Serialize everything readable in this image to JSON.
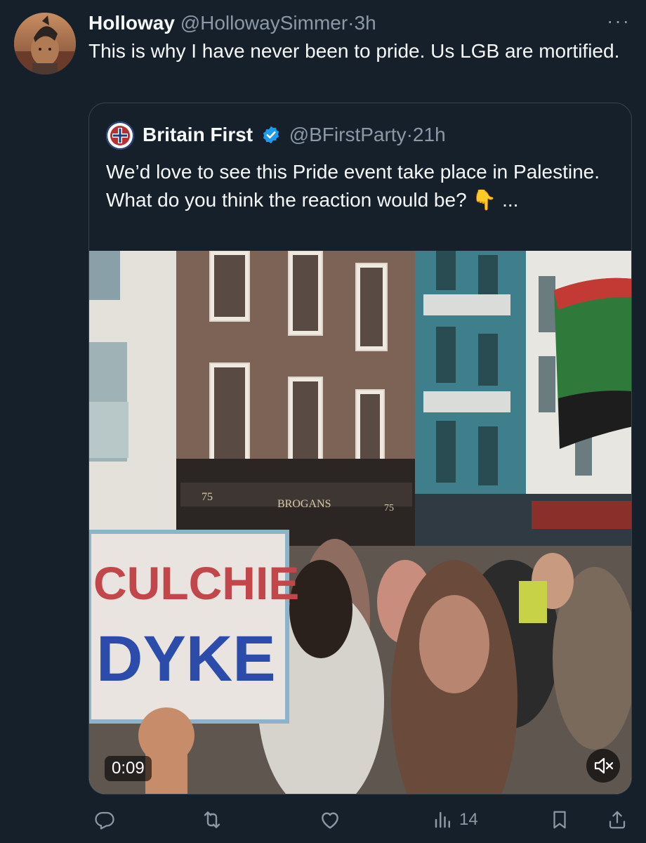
{
  "tweet": {
    "display_name": "Holloway",
    "handle": "@HollowaySimmer",
    "separator": "·",
    "time": "3h",
    "more_label": "···",
    "text": "This is why I have never been to pride. Us LGB are mortified.",
    "avatar_icon": "user-avatar"
  },
  "quote": {
    "display_name": "Britain First",
    "verified_icon": "verified-badge-icon",
    "handle": "@BFirstParty",
    "separator": "·",
    "time": "21h",
    "text": "We’d love to see this Pride event take place in Palestine.\nWhat do you think the reaction would be? 👇 ...",
    "avatar_icon": "britain-first-logo"
  },
  "media": {
    "type": "video",
    "duration": "0:09",
    "mute_icon": "muted-speaker-icon",
    "sign_line_1": "CULCHIE",
    "sign_line_2": "DYKE",
    "shop_sign": "BROGANS",
    "shop_number_left": "75",
    "shop_number_right": "75"
  },
  "actions": {
    "reply_icon": "reply-icon",
    "retweet_icon": "retweet-icon",
    "like_icon": "like-icon",
    "views_icon": "views-icon",
    "views_count": "14",
    "bookmark_icon": "bookmark-icon",
    "share_icon": "share-icon"
  },
  "colors": {
    "background": "#15202b",
    "text_primary": "#f7f9f9",
    "text_secondary": "#8b98a5",
    "border": "#38444d",
    "verified_blue": "#1d9bf0"
  }
}
